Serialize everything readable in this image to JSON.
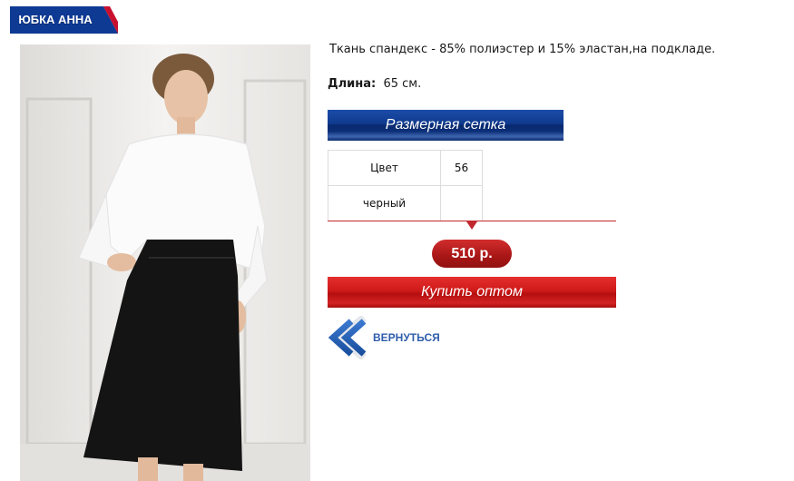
{
  "title": "ЮБКА АННА",
  "description": "Ткань спандекс - 85% полиэстер и 15% эластан,на подкладе.",
  "length": {
    "label": "Длина:",
    "value": "65 см."
  },
  "size_chart_button": "Размерная сетка",
  "size_table": {
    "header": [
      "Цвет",
      "56"
    ],
    "rows": [
      [
        "черный",
        ""
      ]
    ]
  },
  "price": "510 р.",
  "buy_button": "Купить оптом",
  "back_link": "ВЕРНУТЬСЯ",
  "colors": {
    "accent_blue": "#0f3a8e",
    "accent_red": "#c0272d",
    "link_blue": "#2f5eab"
  },
  "icons": [
    "double-chevron-left-icon"
  ]
}
